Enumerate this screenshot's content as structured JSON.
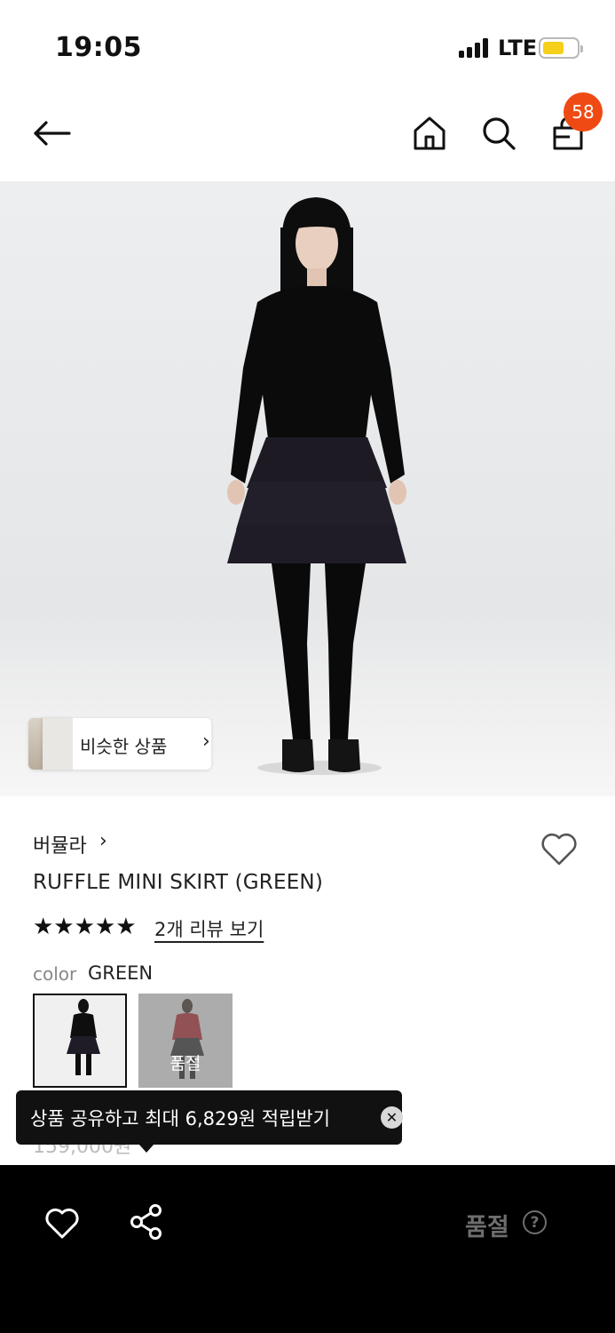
{
  "status_bar": {
    "time": "19:05",
    "network": "LTE"
  },
  "nav": {
    "cart_count": "58"
  },
  "similar": {
    "label": "비슷한 상품",
    "arrow": "›"
  },
  "product": {
    "brand": "버뮬라",
    "brand_arrow": "›",
    "name": "RUFFLE MINI SKIRT (GREEN)",
    "stars": "★★★★★",
    "rating": 5,
    "review_link": "2개 리뷰 보기",
    "color_label": "color",
    "color_value": "GREEN",
    "swatches": [
      {
        "name": "GREEN",
        "selected": true
      },
      {
        "name": "RED",
        "soldout_label": "품절"
      }
    ],
    "price_partial": "159,000원"
  },
  "toast": {
    "text": "상품 공유하고 최대 6,829원 적립받기",
    "close": "✕"
  },
  "bottom_bar": {
    "soldout_label": "품절",
    "help": "?"
  },
  "icons": [
    "back-arrow-icon",
    "home-icon",
    "search-icon",
    "shopping-bag-icon",
    "heart-icon",
    "share-icon",
    "close-icon",
    "help-icon"
  ],
  "colors": {
    "badge": "#f04a14",
    "battery": "#f5cf1a",
    "bottom_bar": "#000000",
    "toast": "#111111"
  }
}
